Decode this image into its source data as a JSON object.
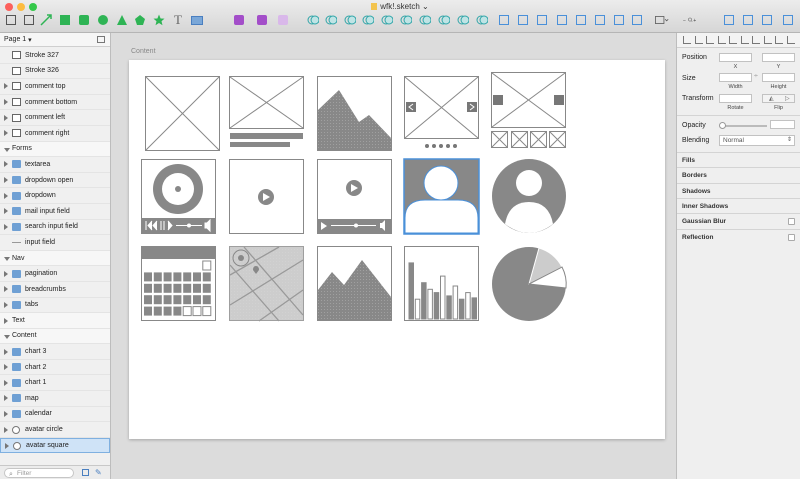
{
  "window": {
    "title": "wfk!.sketch"
  },
  "colors": {
    "accent": "#4a90d9",
    "placeholder": "#888888",
    "red": "#fc605c",
    "yellow": "#fdbc40",
    "green": "#34c84a"
  },
  "left_panel": {
    "page_label": "Page 1",
    "filter_placeholder": "Filter",
    "layers": [
      {
        "label": "Stroke 327",
        "kind": "shape",
        "group": false
      },
      {
        "label": "Stroke 326",
        "kind": "shape",
        "group": false
      },
      {
        "label": "comment top",
        "kind": "shape",
        "group": false,
        "arrow": true
      },
      {
        "label": "comment bottom",
        "kind": "shape",
        "group": false,
        "arrow": true
      },
      {
        "label": "comment left",
        "kind": "shape",
        "group": false,
        "arrow": true
      },
      {
        "label": "comment right",
        "kind": "shape",
        "group": false,
        "arrow": true
      },
      {
        "label": "Forms",
        "kind": "group",
        "group": true
      },
      {
        "label": "textarea",
        "kind": "folder",
        "arrow": true
      },
      {
        "label": "dropdown  open",
        "kind": "folder",
        "arrow": true
      },
      {
        "label": "dropdown",
        "kind": "folder",
        "arrow": true
      },
      {
        "label": "mail input field",
        "kind": "folder",
        "arrow": true
      },
      {
        "label": "search input field",
        "kind": "folder",
        "arrow": true
      },
      {
        "label": "input field",
        "kind": "line"
      },
      {
        "label": "Nav",
        "kind": "group",
        "group": true
      },
      {
        "label": "pagination",
        "kind": "folder",
        "arrow": true
      },
      {
        "label": "breadcrumbs",
        "kind": "folder",
        "arrow": true
      },
      {
        "label": "tabs",
        "kind": "folder",
        "arrow": true
      },
      {
        "label": "Text",
        "kind": "group",
        "group": true,
        "collapsed": true
      },
      {
        "label": "Content",
        "kind": "group",
        "group": true
      },
      {
        "label": "chart 3",
        "kind": "folder",
        "arrow": true
      },
      {
        "label": "chart 2",
        "kind": "folder",
        "arrow": true
      },
      {
        "label": "chart 1",
        "kind": "folder",
        "arrow": true
      },
      {
        "label": "map",
        "kind": "folder",
        "arrow": true
      },
      {
        "label": "calendar",
        "kind": "folder",
        "arrow": true
      },
      {
        "label": "avatar circle",
        "kind": "avatar",
        "arrow": true
      },
      {
        "label": "avatar square",
        "kind": "avatar",
        "arrow": true,
        "selected": true
      }
    ]
  },
  "canvas": {
    "artboard_label": "Content"
  },
  "inspector": {
    "position_label": "Position",
    "x_label": "X",
    "y_label": "Y",
    "size_label": "Size",
    "width_label": "Width",
    "height_label": "Height",
    "transform_label": "Transform",
    "rotate_label": "Rotate",
    "flip_label": "Flip",
    "opacity_label": "Opacity",
    "blending_label": "Blending",
    "blending_value": "Normal",
    "sections": [
      "Fills",
      "Borders",
      "Shadows",
      "Inner Shadows",
      "Gaussian Blur",
      "Reflection"
    ]
  },
  "toolbar": {
    "zoom_minus": "−",
    "zoom_plus": "+"
  }
}
